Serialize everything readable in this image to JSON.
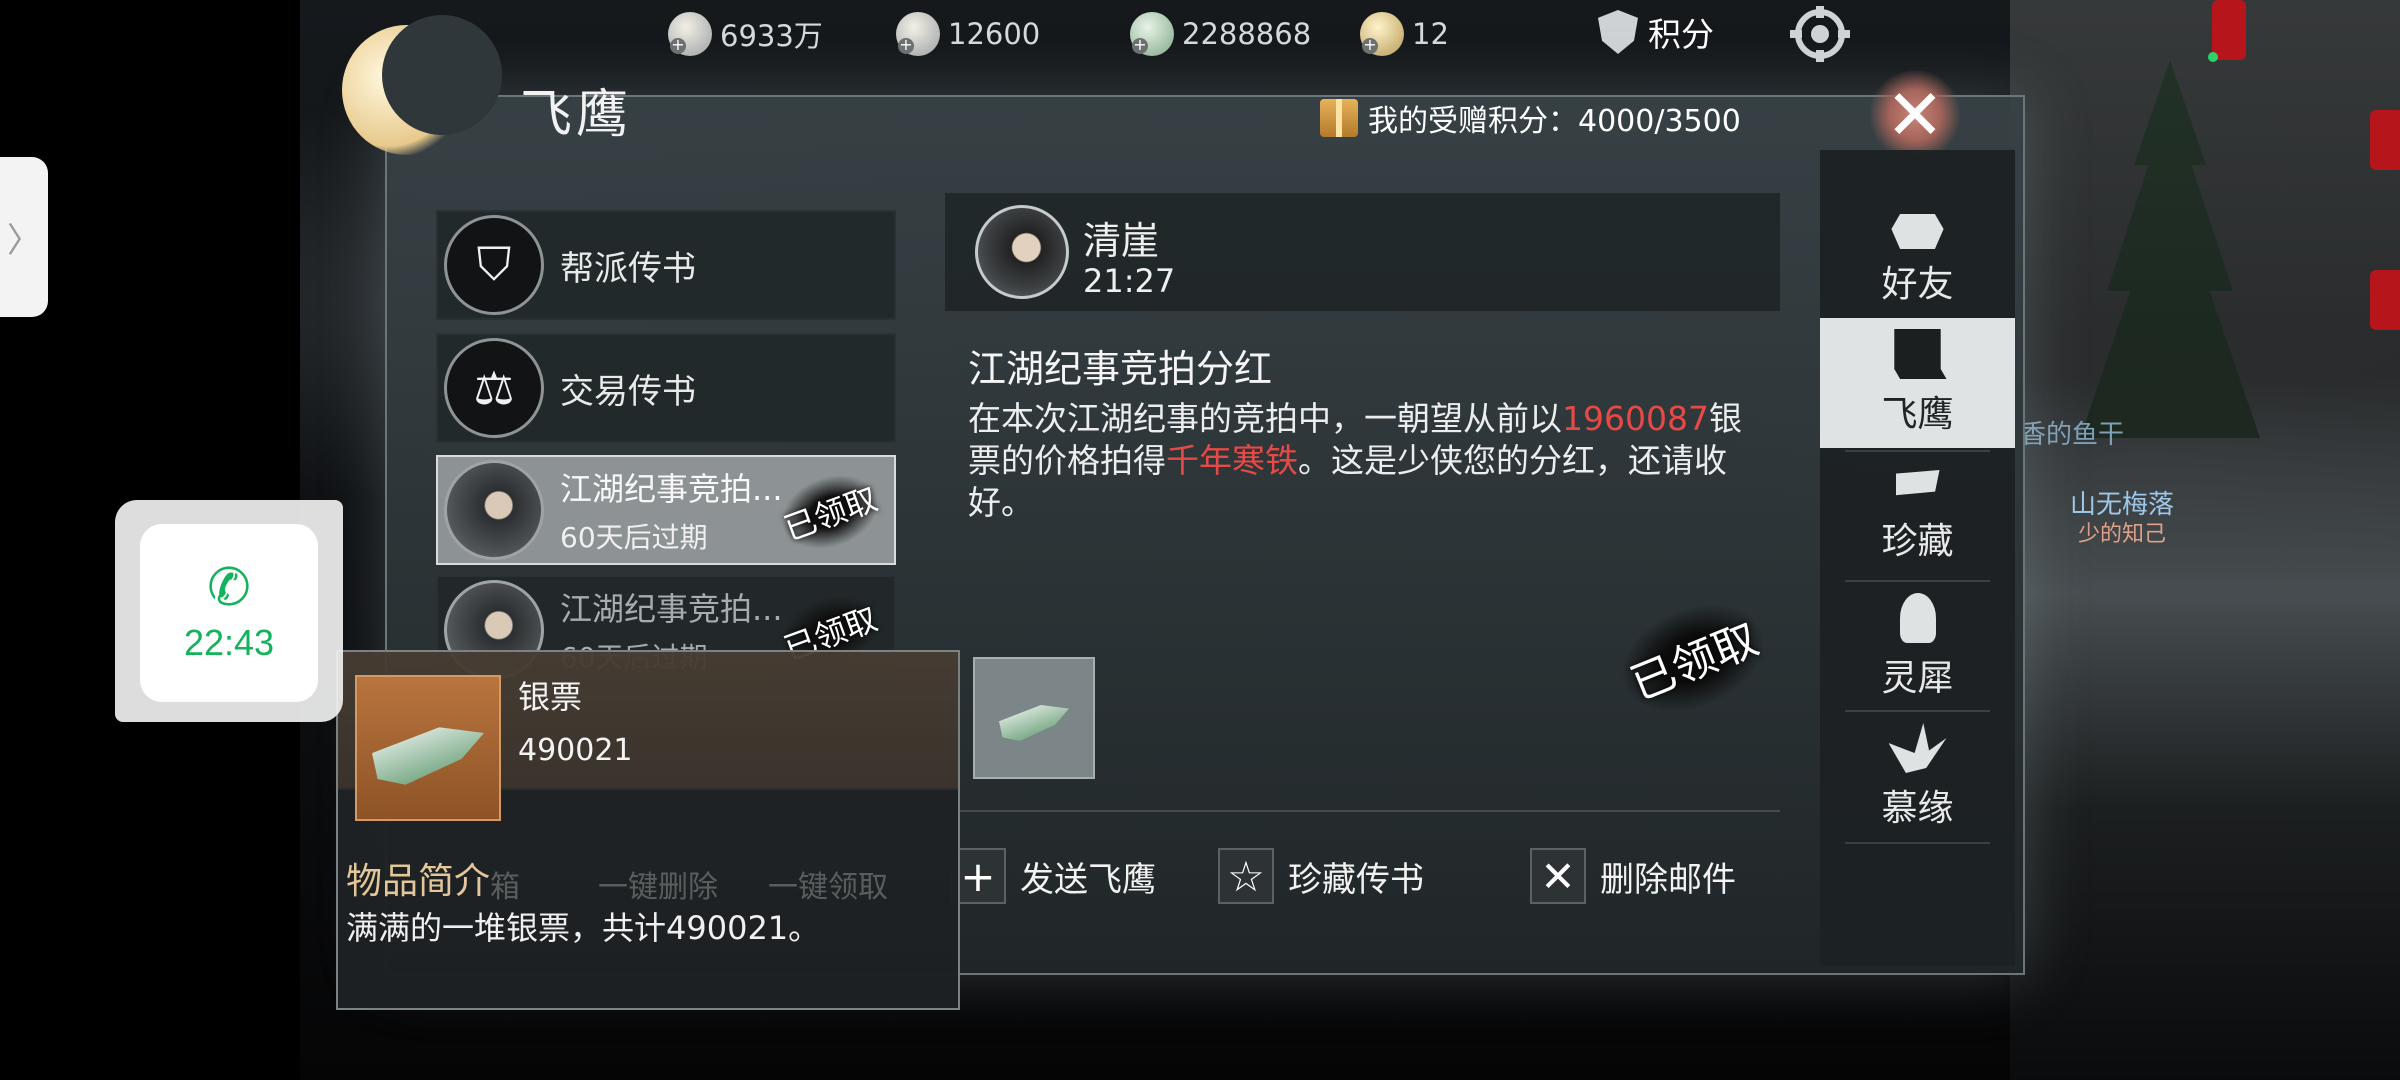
{
  "resources": [
    {
      "icon": "coin-icon",
      "value": "6933万"
    },
    {
      "icon": "ingot-silver-icon",
      "value": "12600"
    },
    {
      "icon": "banknote-icon",
      "value": "2288868"
    },
    {
      "icon": "gold-ingot-icon",
      "value": "12"
    }
  ],
  "top_right": {
    "jifen_label": "积分"
  },
  "panel": {
    "title": "飞鹰",
    "gift_points": "我的受赠积分：4000/3500"
  },
  "mail_list": [
    {
      "label": "帮派传书"
    },
    {
      "label": "交易传书"
    },
    {
      "title": "江湖纪事竞拍...",
      "expire": "60天后过期",
      "stamp": "已领取"
    },
    {
      "title": "江湖纪事竞拍...",
      "expire": "60天后过期",
      "stamp": "已领取"
    }
  ],
  "mail": {
    "sender": "清崖",
    "time": "21:27",
    "title": "江湖纪事竞拍分红",
    "body_1": "在本次江湖纪事的竞拍中，一朝望从前以",
    "body_num": "1960087",
    "body_2": "银票的价格拍得",
    "body_item": "千年寒铁",
    "body_3": "。这是少侠您的分红，还请收好。",
    "stamp": "已领取"
  },
  "actions": {
    "send": "发送飞鹰",
    "favorite": "珍藏传书",
    "delete": "删除邮件"
  },
  "ghost_buttons": [
    "箱",
    "一键删除",
    "一键领取"
  ],
  "tabs": [
    {
      "label": "好友",
      "icon": "teapot-icon"
    },
    {
      "label": "飞鹰",
      "icon": "scroll-icon"
    },
    {
      "label": "珍藏",
      "icon": "flag-icon"
    },
    {
      "label": "灵犀",
      "icon": "bell-icon"
    },
    {
      "label": "慕缘",
      "icon": "crane-icon"
    }
  ],
  "tooltip": {
    "name": "银票",
    "count": "490021",
    "heading": "物品简介",
    "desc": "满满的一堆银票，共计490021。"
  },
  "call": {
    "time": "22:43"
  },
  "scene_labels": {
    "fish": "香的鱼干",
    "player": "山无梅落",
    "relation": "少的知己"
  }
}
